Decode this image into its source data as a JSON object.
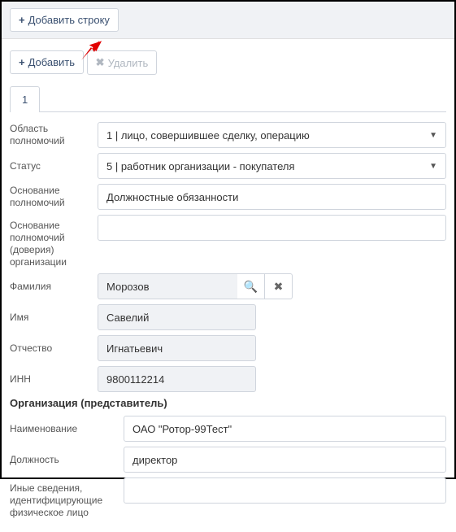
{
  "top": {
    "add_row_label": "Добавить строку"
  },
  "toolbar": {
    "add_label": "Добавить",
    "delete_label": "Удалить"
  },
  "tabs": [
    "1"
  ],
  "form": {
    "authority_area": {
      "label": "Область полномочий",
      "value": "1 | лицо, совершившее сделку, операцию"
    },
    "status": {
      "label": "Статус",
      "value": "5 | работник организации - покупателя"
    },
    "basis": {
      "label": "Основание полномочий",
      "value": "Должностные обязанности"
    },
    "basis_org": {
      "label": "Основание полномочий (доверия) организации",
      "value": ""
    },
    "lastname": {
      "label": "Фамилия",
      "value": "Морозов"
    },
    "firstname": {
      "label": "Имя",
      "value": "Савелий"
    },
    "patronymic": {
      "label": "Отчество",
      "value": "Игнатьевич"
    },
    "inn": {
      "label": "ИНН",
      "value": "9800112214"
    },
    "org_section": "Организация (представитель)",
    "org_name": {
      "label": "Наименование",
      "value": "ОАО \"Ротор-99Тест\""
    },
    "position": {
      "label": "Должность",
      "value": "директор"
    },
    "other_info": {
      "label": "Иные сведения, идентифицирующие физическое лицо",
      "value": ""
    }
  }
}
